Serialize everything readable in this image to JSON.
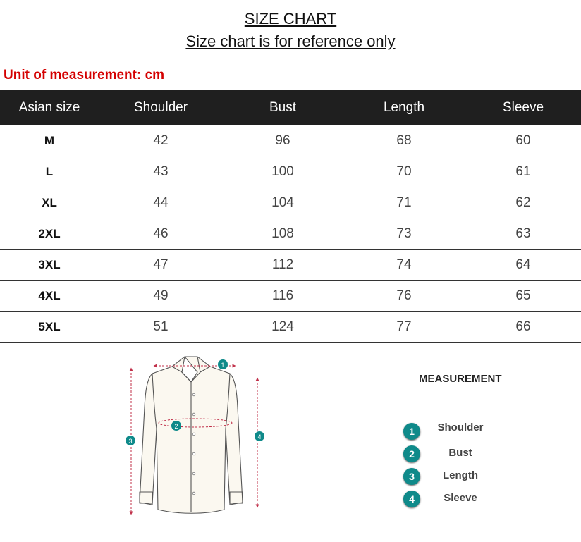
{
  "header": {
    "title": "SIZE CHART",
    "subtitle": "Size chart is for reference only",
    "unit_note": "Unit of measurement: cm"
  },
  "table": {
    "headers": [
      "Asian size",
      "Shoulder",
      "Bust",
      "Length",
      "Sleeve"
    ],
    "rows": [
      [
        "M",
        "42",
        "96",
        "68",
        "60"
      ],
      [
        "L",
        "43",
        "100",
        "70",
        "61"
      ],
      [
        "XL",
        "44",
        "104",
        "71",
        "62"
      ],
      [
        "2XL",
        "46",
        "108",
        "73",
        "63"
      ],
      [
        "3XL",
        "47",
        "112",
        "74",
        "64"
      ],
      [
        "4XL",
        "49",
        "116",
        "76",
        "65"
      ],
      [
        "5XL",
        "51",
        "124",
        "77",
        "66"
      ]
    ]
  },
  "diagram": {
    "markers": [
      "1",
      "2",
      "3",
      "4"
    ],
    "marker_color": "#0f8a8a",
    "measure_line_color": "#c0304a"
  },
  "legend": {
    "title": "MEASUREMENT",
    "items": [
      {
        "num": "1",
        "label": "Shoulder"
      },
      {
        "num": "2",
        "label": "Bust"
      },
      {
        "num": "3",
        "label": "Length"
      },
      {
        "num": "4",
        "label": "Sleeve"
      }
    ]
  },
  "colors": {
    "header_bg": "#1f1f1f",
    "unit_text": "#d40000",
    "accent": "#0f8a8a"
  }
}
